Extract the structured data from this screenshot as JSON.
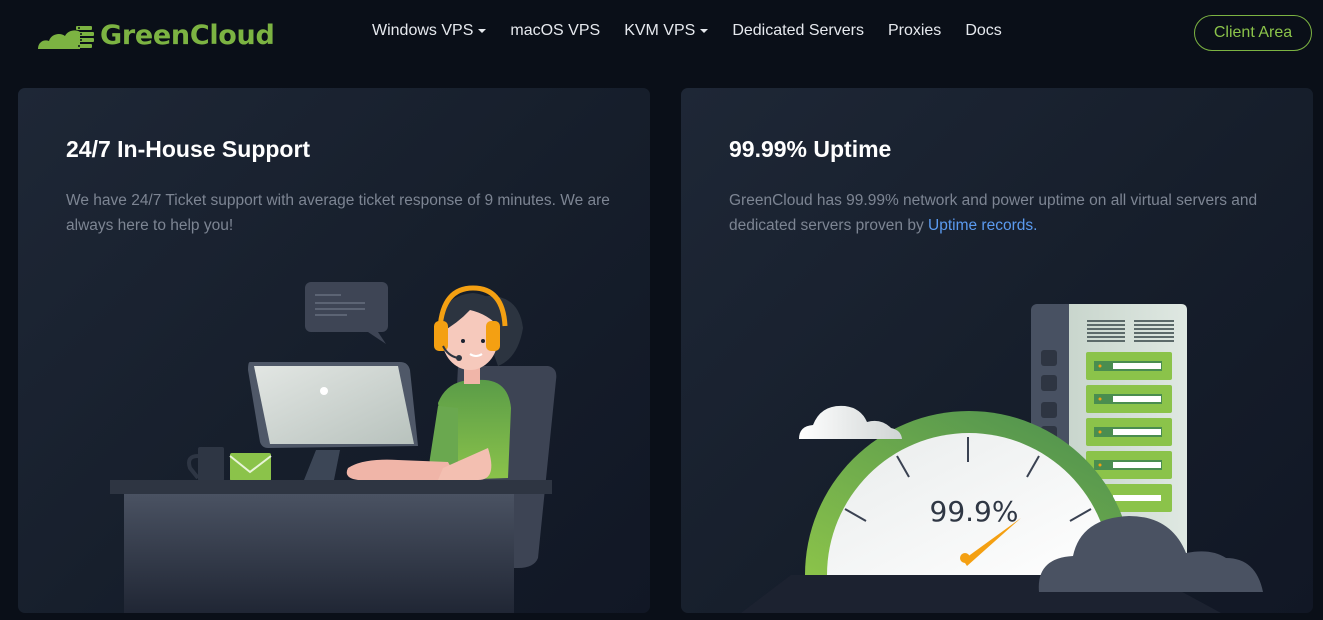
{
  "brand": {
    "name": "GreenCloud",
    "accent": "#7cb342"
  },
  "nav": {
    "items": [
      {
        "label": "Windows VPS",
        "dropdown": true
      },
      {
        "label": "macOS VPS",
        "dropdown": false
      },
      {
        "label": "KVM VPS",
        "dropdown": true
      },
      {
        "label": "Dedicated Servers",
        "dropdown": false
      },
      {
        "label": "Proxies",
        "dropdown": false
      },
      {
        "label": "Docs",
        "dropdown": false
      }
    ],
    "client_area": "Client Area"
  },
  "cards": {
    "support": {
      "title": "24/7 In-House Support",
      "text": "We have 24/7 Ticket support with average ticket response of 9 minutes. We are always here to help you!"
    },
    "uptime": {
      "title": "99.99% Uptime",
      "text_before": "GreenCloud has 99.99% network and power uptime on all virtual servers and dedicated servers proven by ",
      "link_text": "Uptime records.",
      "gauge_label": "99.9%"
    }
  }
}
